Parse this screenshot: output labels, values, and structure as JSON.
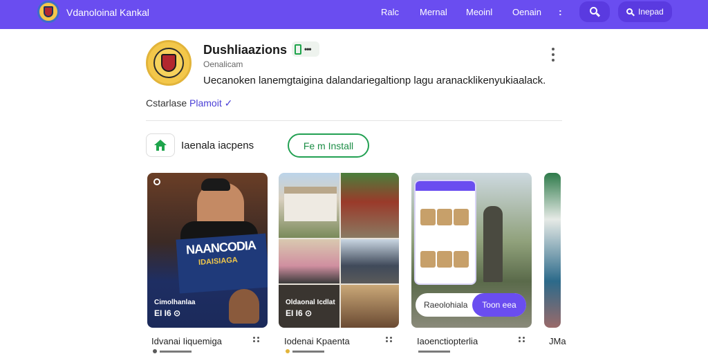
{
  "topbar": {
    "brand": "Vdanoloinal Kankal",
    "nav": [
      "Ralc",
      "Mernal",
      "Meoinl",
      "Oenain"
    ],
    "more": ":",
    "search_label": "Inepad",
    "color": "#6a4df0"
  },
  "app": {
    "title": "Dushliaazions",
    "developer": "Oenalicam",
    "description": "Uecanoken lanemgtaigina dalandariegaltionp lagu aranacklikenyukiaalack.",
    "rating_prefix": "Cstarlase",
    "rating_link": "Plamoit",
    "rating_check": "✓",
    "badge_dots": "•••"
  },
  "actions": {
    "home_label": "Iaenala iacpens",
    "install_label": "Fe m Install"
  },
  "gallery": [
    {
      "poster_title": "NAANCODIA",
      "poster_sub": "IDAISIAGA",
      "caption": "Cimolhanlaa",
      "meta": "EI I6 ⊙",
      "title": "Idvanai Iiquemiga"
    },
    {
      "caption": "Oldaonal Icdlat",
      "meta": "EI I6 ⊙",
      "title": "Iodenai Kpaenta"
    },
    {
      "pill_left": "Raeolohiala",
      "pill_right": "Toon eea",
      "title": "Iaoenctiopterlia"
    },
    {
      "title": "JMa"
    }
  ]
}
